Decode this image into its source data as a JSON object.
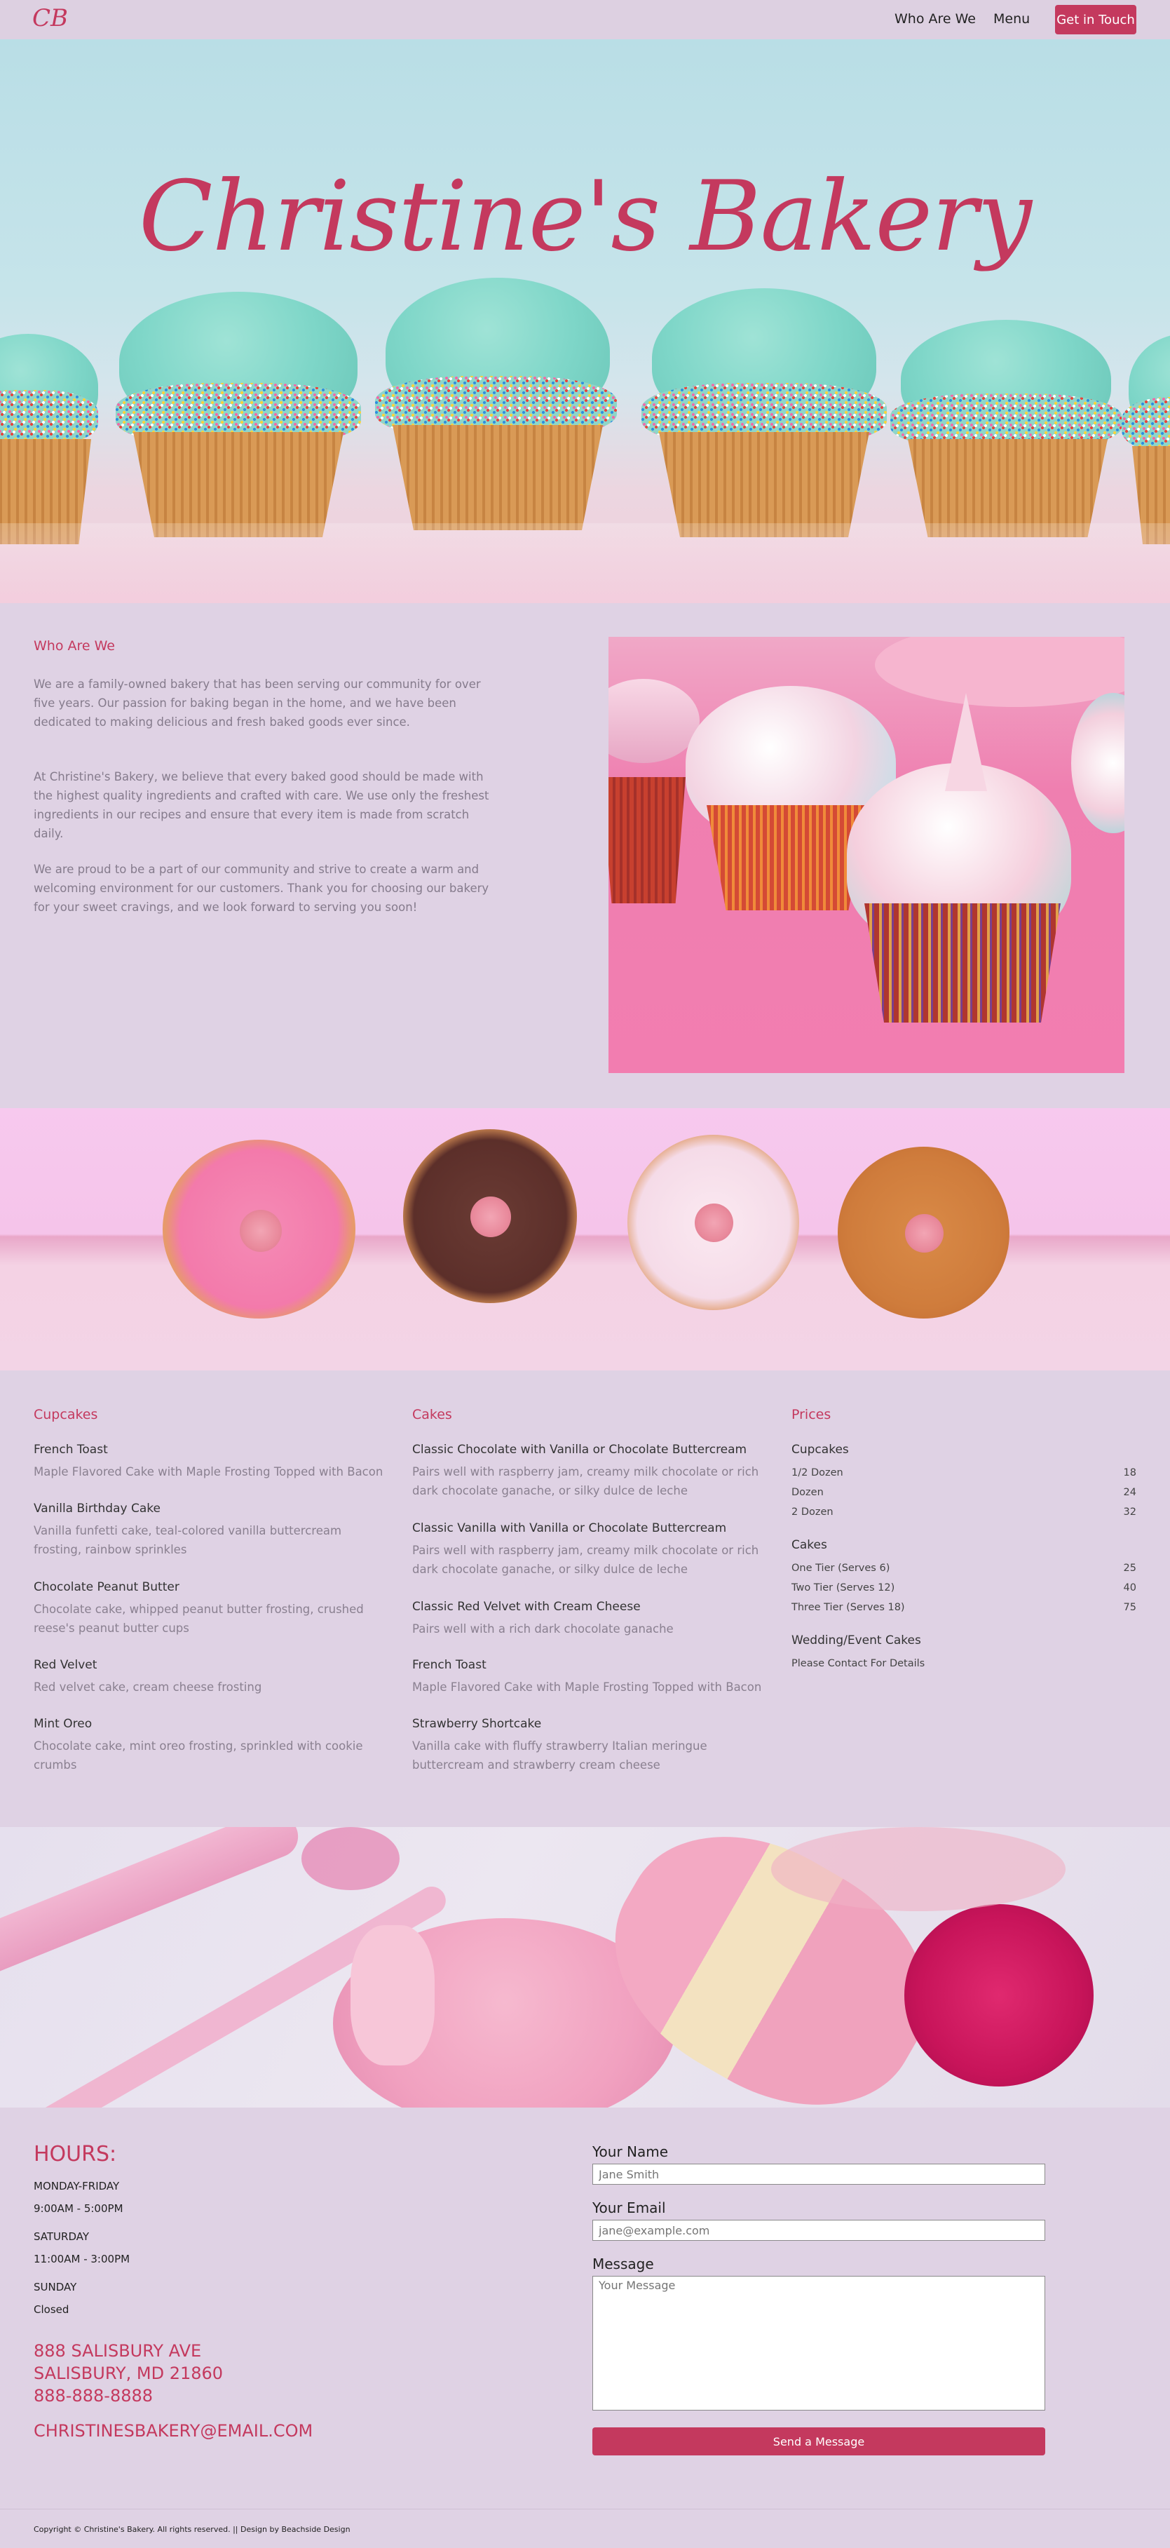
{
  "nav": {
    "logo": "CB",
    "links": [
      "Who Are We",
      "Menu"
    ],
    "cta": "Get in Touch"
  },
  "hero": {
    "title": "Christine's Bakery"
  },
  "about": {
    "heading": "Who Are We",
    "paragraphs": [
      "We are a family-owned bakery that has been serving our community for over five years. Our passion for baking began in the home, and we have been dedicated to making delicious and fresh baked goods ever since.",
      "At Christine's Bakery, we believe that every baked good should be made with the highest quality ingredients and crafted with care. We use only the freshest ingredients in our recipes and ensure that every item is made from scratch daily.",
      "We are proud to be a part of our community and strive to create a warm and welcoming environment for our customers. Thank you for choosing our bakery for your sweet cravings, and we look forward to serving you soon!"
    ]
  },
  "menu": {
    "cupcakes": {
      "heading": "Cupcakes",
      "items": [
        {
          "name": "French Toast",
          "desc": "Maple Flavored Cake with Maple Frosting Topped with Bacon"
        },
        {
          "name": "Vanilla Birthday Cake",
          "desc": "Vanilla funfetti cake, teal-colored vanilla buttercream frosting, rainbow sprinkles"
        },
        {
          "name": "Chocolate Peanut Butter",
          "desc": "Chocolate cake, whipped peanut butter frosting, crushed reese's peanut butter cups"
        },
        {
          "name": "Red Velvet",
          "desc": "Red velvet cake, cream cheese frosting"
        },
        {
          "name": "Mint Oreo",
          "desc": "Chocolate cake, mint oreo frosting, sprinkled with cookie crumbs"
        }
      ]
    },
    "cakes": {
      "heading": "Cakes",
      "items": [
        {
          "name": "Classic Chocolate with Vanilla or Chocolate Buttercream",
          "desc": "Pairs well with raspberry jam, creamy milk chocolate or rich dark chocolate ganache, or silky dulce de leche"
        },
        {
          "name": "Classic Vanilla with Vanilla or Chocolate Buttercream",
          "desc": "Pairs well with raspberry jam, creamy milk chocolate or rich dark chocolate ganache, or silky dulce de leche"
        },
        {
          "name": "Classic Red Velvet with Cream Cheese",
          "desc": "Pairs well with a rich dark chocolate ganache"
        },
        {
          "name": "French Toast",
          "desc": "Maple Flavored Cake with Maple Frosting Topped with Bacon"
        },
        {
          "name": "Strawberry Shortcake",
          "desc": "Vanilla cake with fluffy strawberry Italian meringue buttercream and strawberry cream cheese"
        }
      ]
    },
    "prices": {
      "heading": "Prices",
      "groups": [
        {
          "title": "Cupcakes",
          "rows": [
            {
              "label": "1/2 Dozen",
              "price": "18"
            },
            {
              "label": "Dozen",
              "price": "24"
            },
            {
              "label": "2 Dozen",
              "price": "32"
            }
          ]
        },
        {
          "title": "Cakes",
          "rows": [
            {
              "label": "One Tier (Serves 6)",
              "price": "25"
            },
            {
              "label": "Two Tier (Serves 12)",
              "price": "40"
            },
            {
              "label": "Three Tier (Serves 18)",
              "price": "75"
            }
          ]
        }
      ],
      "wedding_title": "Wedding/Event Cakes",
      "wedding_note": "Please Contact For Details"
    }
  },
  "contact": {
    "hours_heading": "HOURS:",
    "hours": [
      {
        "day": "MONDAY-FRIDAY",
        "time": "9:00AM - 5:00PM"
      },
      {
        "day": "SATURDAY",
        "time": "11:00AM - 3:00PM"
      },
      {
        "day": "SUNDAY",
        "time": "Closed"
      }
    ],
    "address1": "888 SALISBURY AVE",
    "address2": "SALISBURY, MD 21860",
    "phone": "888-888-8888",
    "email": "CHRISTINESBAKERY@EMAIL.COM",
    "form": {
      "name_label": "Your Name",
      "name_placeholder": "Jane Smith",
      "email_label": "Your Email",
      "email_placeholder": "jane@example.com",
      "message_label": "Message",
      "message_placeholder": "Your Message",
      "submit": "Send a Message"
    }
  },
  "footer": {
    "text": "Copyright © Christine's Bakery. All rights reserved. || Design by Beachside Design"
  },
  "colors": {
    "accent": "#c4395e",
    "background": "#dfd2e4"
  }
}
